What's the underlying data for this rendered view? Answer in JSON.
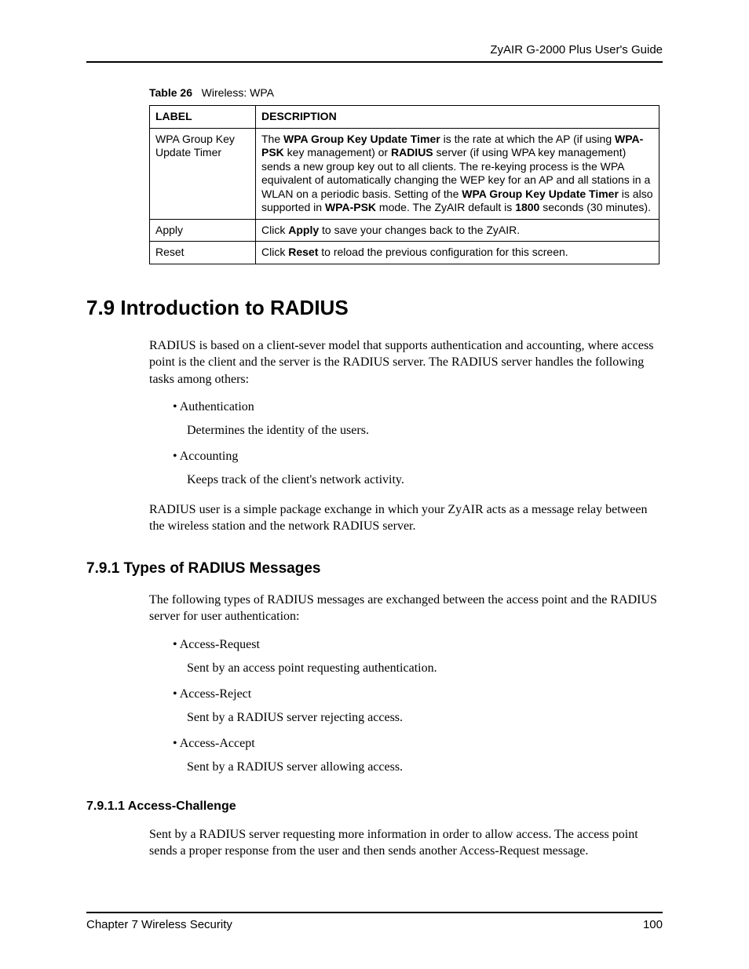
{
  "header": {
    "title": "ZyAIR G-2000 Plus User's Guide"
  },
  "table": {
    "caption_number": "Table 26",
    "caption_text": "Wireless: WPA",
    "headers": {
      "label": "LABEL",
      "description": "DESCRIPTION"
    },
    "rows": [
      {
        "label": "WPA Group Key Update Timer",
        "desc_prefix": "The ",
        "b1": "WPA Group Key Update Timer",
        "t1": " is the rate at which the AP (if using ",
        "b2": "WPA-PSK",
        "t2": " key management) or ",
        "b3": "RADIUS",
        "t3": " server (if using WPA key management) sends a new group key out to all clients. The re-keying process is the WPA equivalent of automatically changing the WEP key for an AP and all stations in a WLAN on a periodic basis. Setting of the ",
        "b4": "WPA Group Key Update Timer",
        "t4": " is also supported in ",
        "b5": "WPA-PSK",
        "t5": " mode. The ZyAIR default is ",
        "b6": "1800",
        "t6": " seconds (30 minutes)."
      },
      {
        "label": "Apply",
        "desc_prefix": "Click ",
        "b1": "Apply",
        "t1": " to save your changes back to the ZyAIR."
      },
      {
        "label": "Reset",
        "desc_prefix": "Click ",
        "b1": "Reset",
        "t1": " to reload the previous configuration for this screen."
      }
    ]
  },
  "section79": {
    "heading": "7.9  Introduction to RADIUS",
    "para1": "RADIUS is based on a client-sever model that supports authentication and accounting, where access point is the client and the server is the RADIUS server. The RADIUS server handles the following tasks among others:",
    "bullets": [
      {
        "head": "Authentication",
        "desc": "Determines the identity of the users."
      },
      {
        "head": "Accounting",
        "desc": "Keeps track of the client's network activity."
      }
    ],
    "para2": "RADIUS user is a simple package exchange in which your ZyAIR acts as a message relay between the wireless station and the network RADIUS server."
  },
  "section791": {
    "heading": "7.9.1  Types of RADIUS Messages",
    "para1": "The following types of RADIUS messages are exchanged between the access point and the RADIUS server for user authentication:",
    "bullets": [
      {
        "head": "Access-Request",
        "desc": "Sent by an access point requesting authentication."
      },
      {
        "head": "Access-Reject",
        "desc": "Sent by a RADIUS server rejecting access."
      },
      {
        "head": "Access-Accept",
        "desc": "Sent by a RADIUS server allowing access."
      }
    ]
  },
  "section7911": {
    "heading": "7.9.1.1  Access-Challenge",
    "para1": "Sent by a RADIUS server requesting more information in order to allow access. The access point sends a proper response from the user and then sends another Access-Request message."
  },
  "footer": {
    "chapter": "Chapter 7 Wireless Security",
    "page": "100"
  }
}
